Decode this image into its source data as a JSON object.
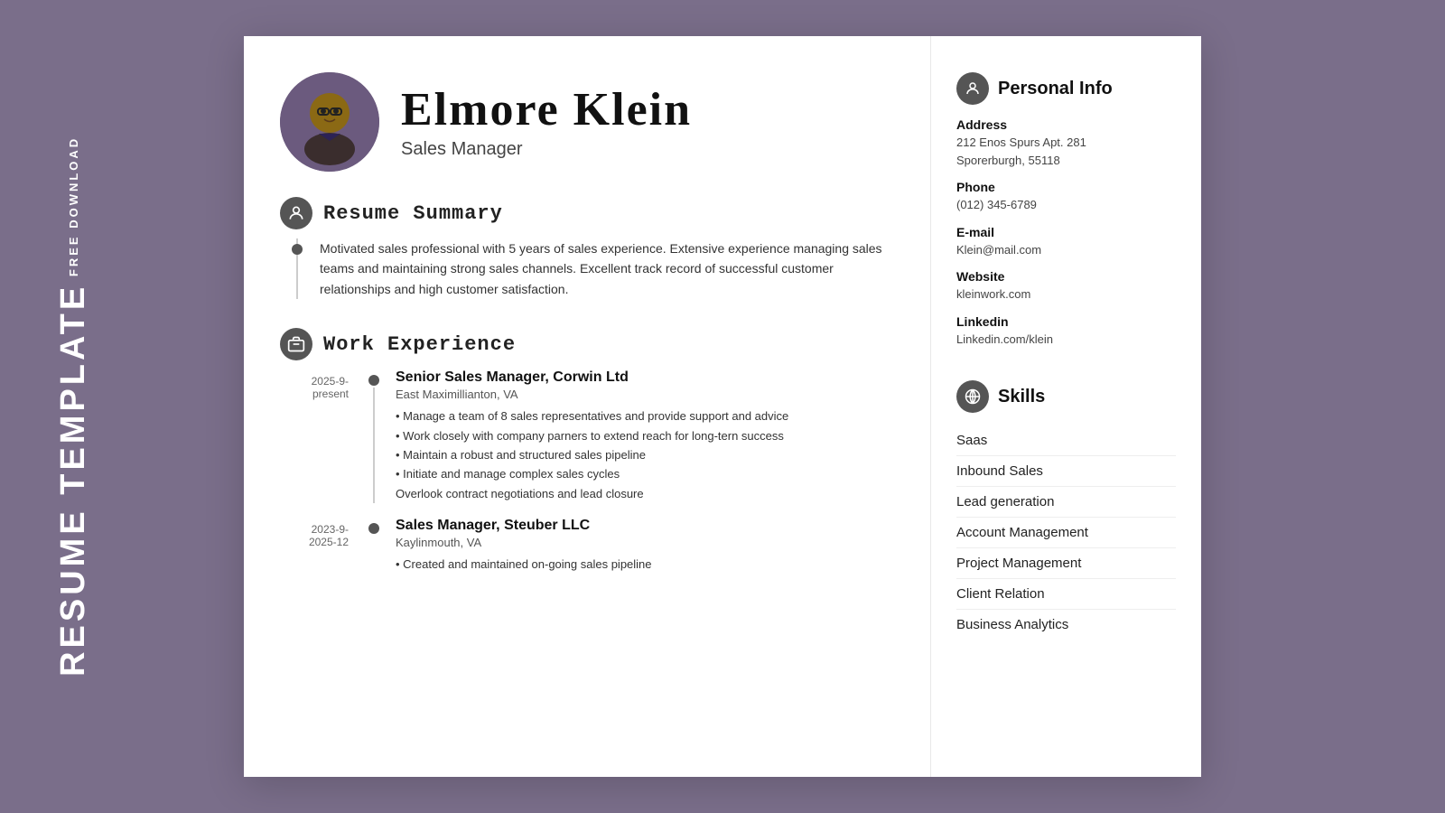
{
  "side": {
    "free_download": "FREE DOWNLOAD",
    "resume_template": "RESUME TEMPLATE"
  },
  "header": {
    "name": "Elmore Klein",
    "title": "Sales Manager"
  },
  "summary": {
    "section_title": "Resume Summary",
    "text": "Motivated sales professional with 5 years of sales experience. Extensive experience managing sales teams and maintaining strong sales channels. Excellent track record of successful customer relationships and high customer satisfaction."
  },
  "work_experience": {
    "section_title": "Work Experience",
    "jobs": [
      {
        "date": "2025-9-\npresent",
        "position": "Senior Sales Manager, Corwin Ltd",
        "location": "East Maximillianton, VA",
        "bullets": [
          "• Manage a team of 8 sales representatives and provide support and advice",
          "• Work closely with company parners to extend reach for long-tern success",
          "• Maintain a robust and structured sales pipeline",
          "• Initiate and manage complex sales cycles",
          "Overlook contract negotiations and lead closure"
        ]
      },
      {
        "date": "2023-9-\n2025-12",
        "position": "Sales Manager, Steuber LLC",
        "location": "Kaylinmouth, VA",
        "bullets": [
          "• Created and maintained on-going sales pipeline"
        ]
      }
    ]
  },
  "personal_info": {
    "section_title": "Personal Info",
    "fields": [
      {
        "label": "Address",
        "value": "212 Enos Spurs Apt. 281\nSporerburgh, 55118"
      },
      {
        "label": "Phone",
        "value": "(012) 345-6789"
      },
      {
        "label": "E-mail",
        "value": "Klein@mail.com"
      },
      {
        "label": "Website",
        "value": "kleinwork.com"
      },
      {
        "label": "Linkedin",
        "value": "Linkedin.com/klein"
      }
    ]
  },
  "skills": {
    "section_title": "Skills",
    "items": [
      "Saas",
      "Inbound Sales",
      "Lead generation",
      "Account Management",
      "Project Management",
      "Client Relation",
      "Business Analytics"
    ]
  }
}
